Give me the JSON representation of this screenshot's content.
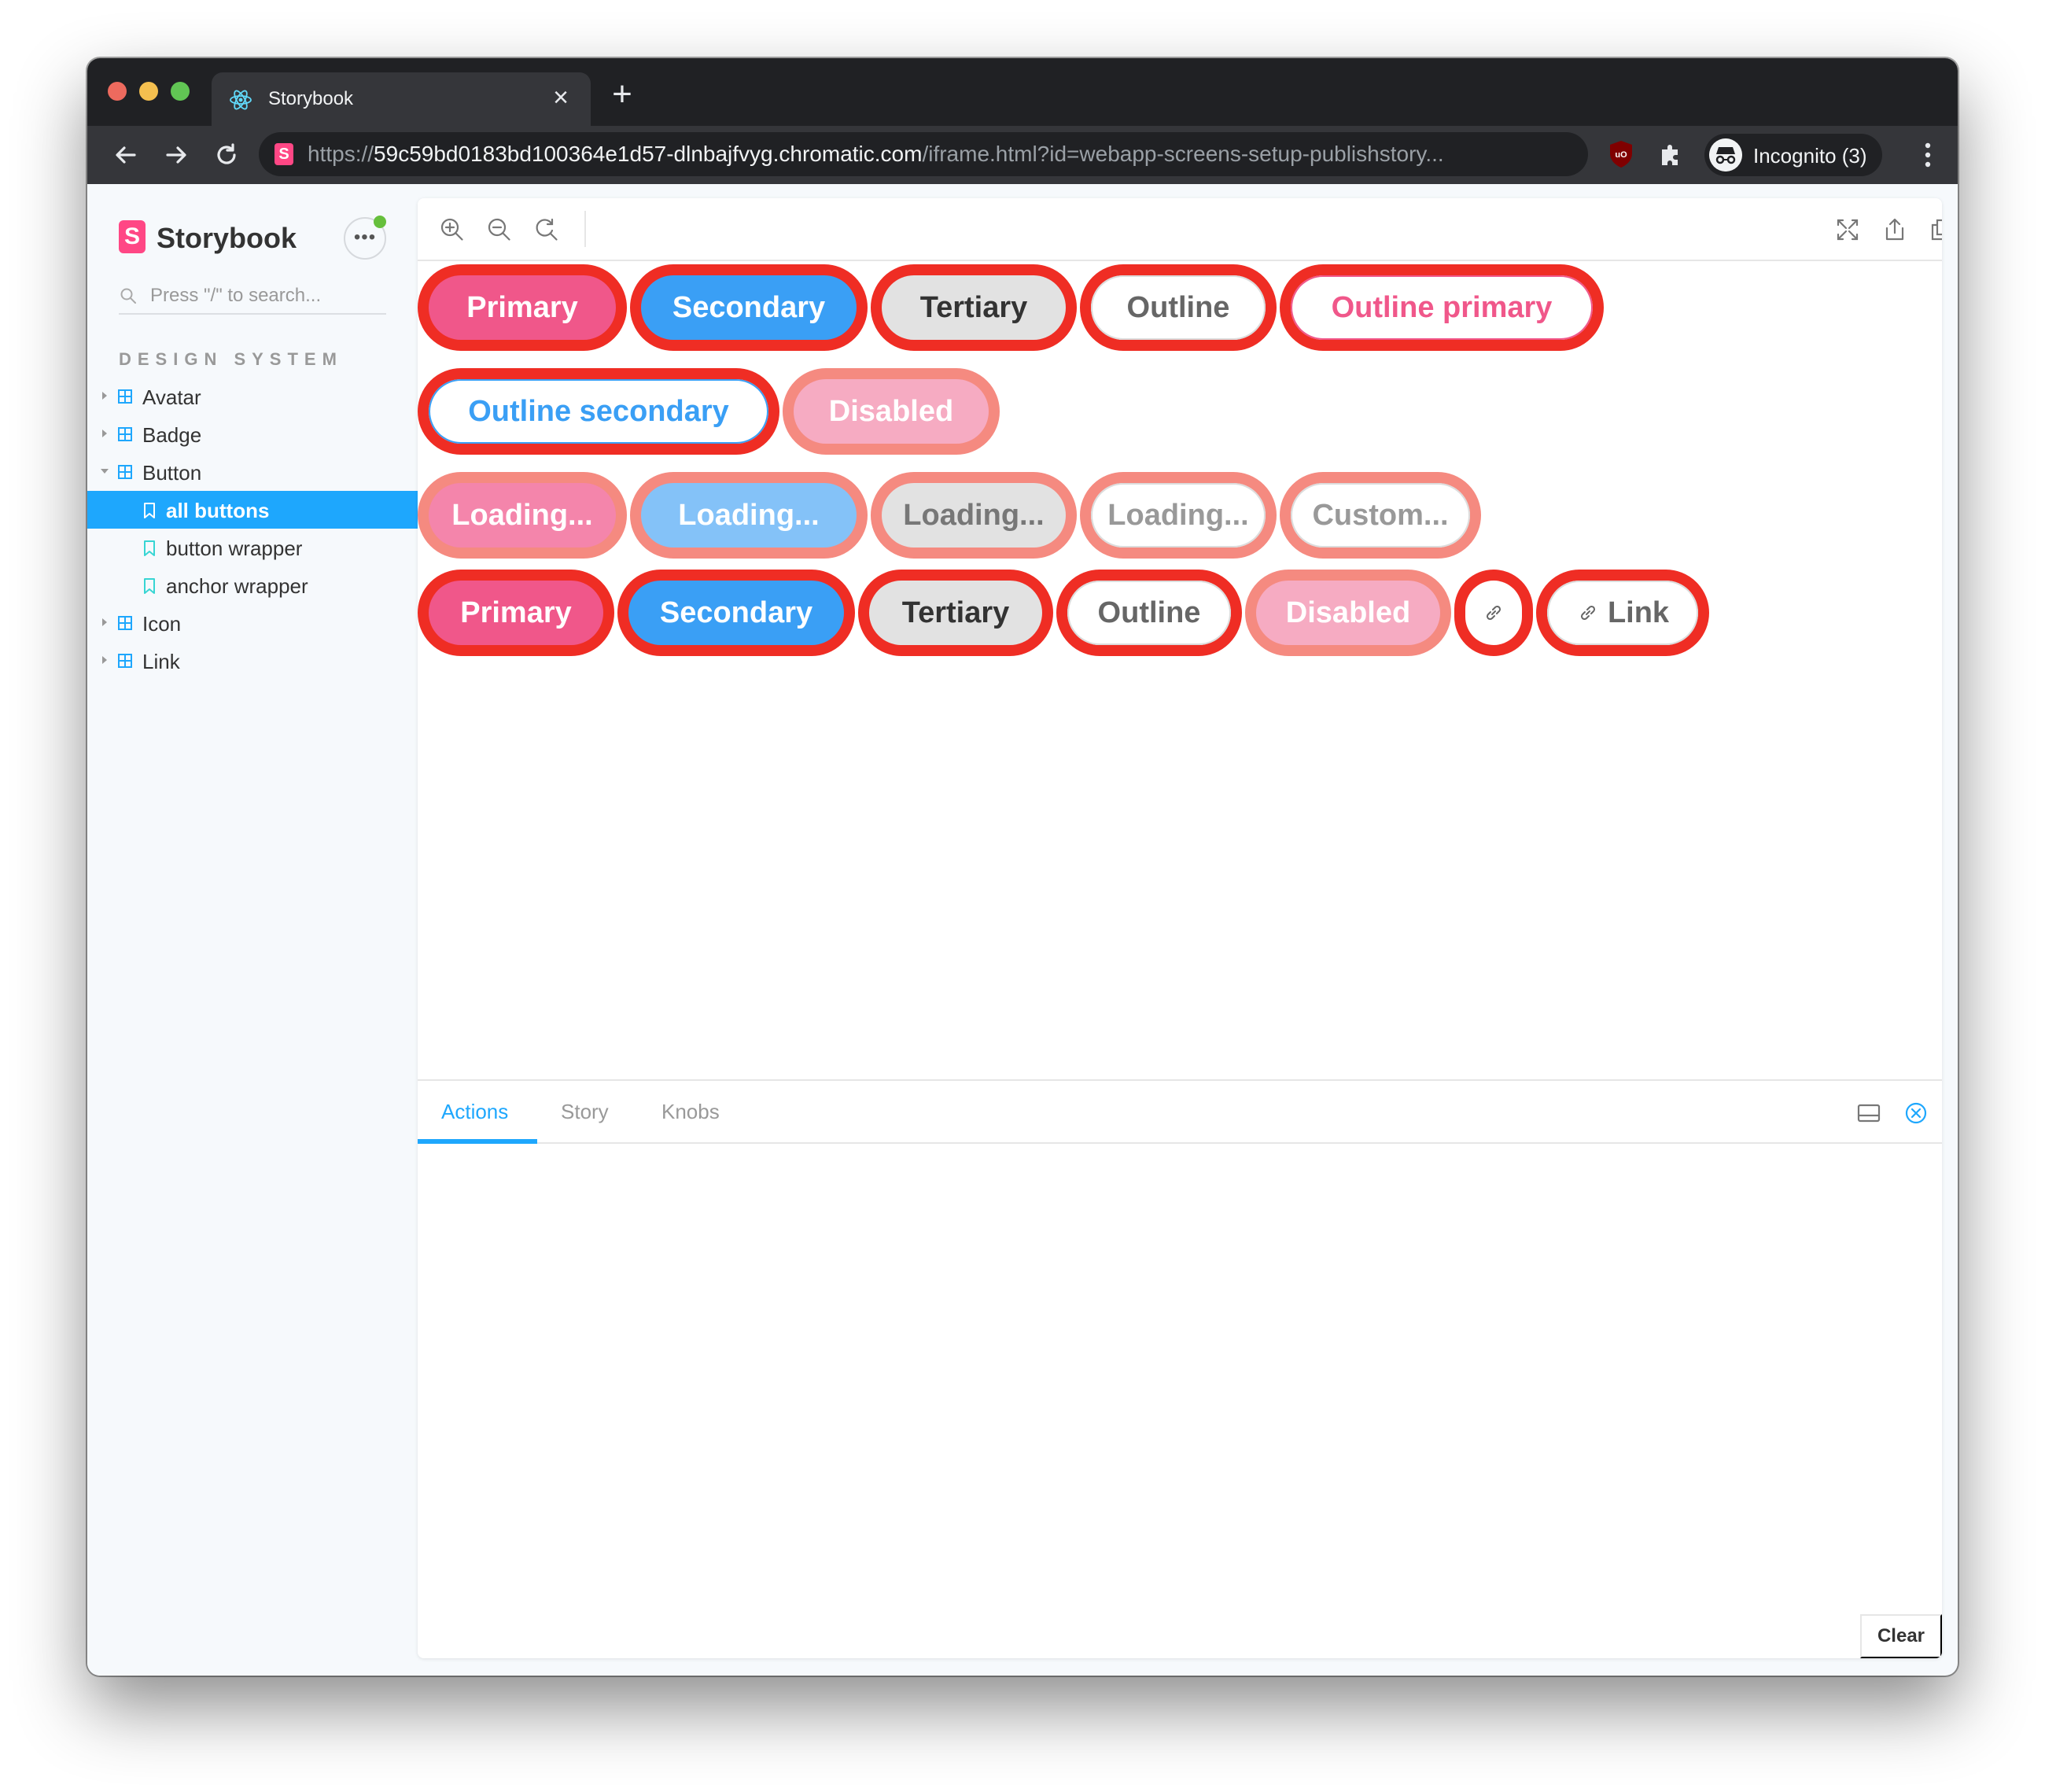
{
  "browser": {
    "tab_title": "Storybook",
    "tab_close": "×",
    "new_tab": "+",
    "url_host": "https://59c59bd0183bd100364e1d57-dlnbajfvyg.chromatic.com",
    "url_path": "/iframe.html?id=webapp-screens-setup-publishstory...",
    "url_scheme_dim": "https://",
    "url_host_only": "59c59bd0183bd100364e1d57-dlnbajfvyg.chromatic.com",
    "profile_label": "Incognito (3)",
    "site_icon": "S"
  },
  "sidebar": {
    "brand_mark": "S",
    "brand_name": "Storybook",
    "more_dots": "•••",
    "search_placeholder": "Press \"/\" to search...",
    "section_title": "DESIGN SYSTEM",
    "items": [
      {
        "label": "Avatar",
        "type": "component",
        "expanded": false
      },
      {
        "label": "Badge",
        "type": "component",
        "expanded": false
      },
      {
        "label": "Button",
        "type": "component",
        "expanded": true
      },
      {
        "label": "all buttons",
        "type": "story",
        "selected": true
      },
      {
        "label": "button wrapper",
        "type": "story",
        "selected": false
      },
      {
        "label": "anchor wrapper",
        "type": "story",
        "selected": false
      },
      {
        "label": "Icon",
        "type": "component",
        "expanded": false
      },
      {
        "label": "Link",
        "type": "component",
        "expanded": false
      }
    ]
  },
  "canvas": {
    "row1": [
      "Primary",
      "Secondary",
      "Tertiary",
      "Outline",
      "Outline primary"
    ],
    "row2": [
      "Outline secondary",
      "Disabled"
    ],
    "row3": [
      "Loading...",
      "Loading...",
      "Loading...",
      "Loading...",
      "Custom..."
    ],
    "row4": [
      "Primary",
      "Secondary",
      "Tertiary",
      "Outline",
      "Disabled",
      "",
      "Link"
    ]
  },
  "addons": {
    "tabs": [
      "Actions",
      "Story",
      "Knobs"
    ],
    "active_tab": "Actions",
    "clear_label": "Clear"
  },
  "colors": {
    "accent": "#1ea7fd",
    "storybook_pink": "#ff4785",
    "highlight_outline": "#ef2d24",
    "primary": "#f0578a",
    "secondary": "#3a9ff5"
  },
  "icons": {
    "zoom_in": "zoom-in-icon",
    "zoom_out": "zoom-out-icon",
    "zoom_reset": "zoom-reset-icon",
    "fullscreen": "fullscreen-icon",
    "share": "share-icon",
    "copy": "copy-icon",
    "panel_layout": "panel-layout-icon",
    "close_panel": "close-circle-icon",
    "link": "link-icon"
  }
}
